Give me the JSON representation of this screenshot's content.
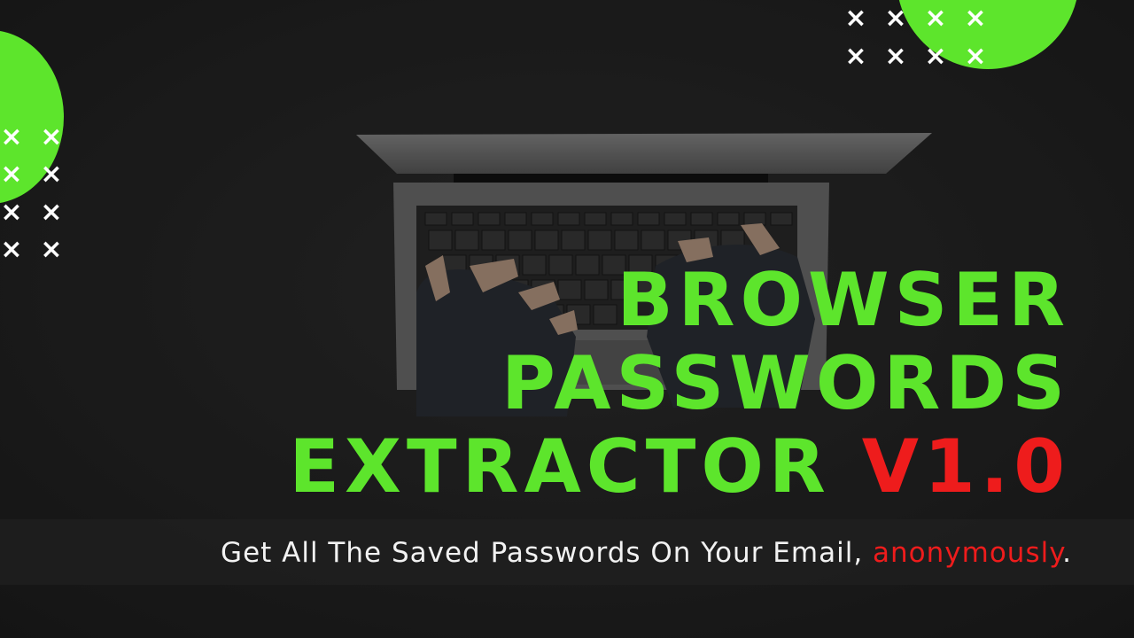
{
  "colors": {
    "accent_green": "#5de52c",
    "accent_red": "#ee1c1c",
    "background": "#232323",
    "subtitle_text": "#f2f2f2"
  },
  "decor": {
    "mark_glyph": "×",
    "mark_icon": "cross-mark-icon"
  },
  "headline": {
    "line1": "BROWSER",
    "line2": "PASSWORDS",
    "line3": "EXTRACTOR",
    "version": "V1.0"
  },
  "tagline": {
    "main": "Get All The Saved Passwords On Your Email,",
    "highlight": "anonymously",
    "end": "."
  }
}
